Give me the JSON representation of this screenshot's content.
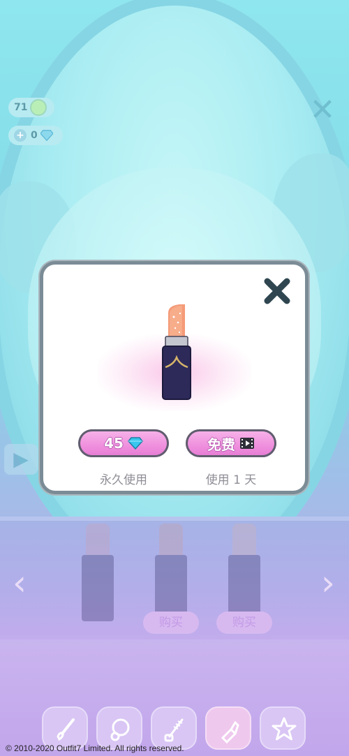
{
  "hud": {
    "coins": "71",
    "gems": "0",
    "plus_label": "+"
  },
  "background": {
    "buy_labels": [
      "购买",
      "购买"
    ],
    "left_arrow": "‹",
    "right_arrow": "›"
  },
  "dialog": {
    "buy_price": "45",
    "buy_caption": "永久使用",
    "free_label": "免费",
    "free_caption": "使用 1 天"
  },
  "toolbar": {
    "tools": [
      "brush-icon",
      "compact-icon",
      "mascara-icon",
      "lipstick-icon",
      "star-icon"
    ],
    "active": "lipstick-icon"
  },
  "footer": {
    "copyright": "© 2010-2020 Outfit7 Limited. All rights reserved."
  },
  "colors": {
    "button_pink": "#ef8fdd",
    "gem_blue": "#39c6ef",
    "lipstick_case": "#2d2a5a",
    "lipstick_bullet": "#f59a78"
  }
}
